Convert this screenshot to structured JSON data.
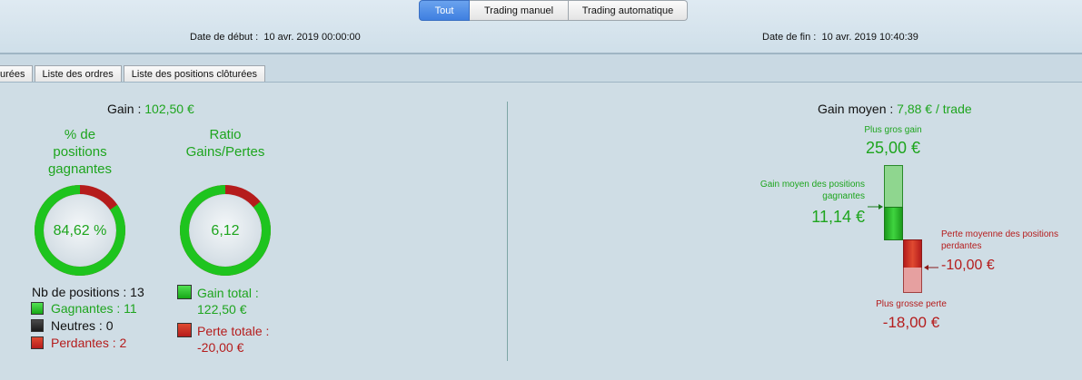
{
  "filter_tabs": [
    "Tout",
    "Trading manuel",
    "Trading automatique"
  ],
  "dates": {
    "start_label": "Date de début :",
    "start_value": "10 avr. 2019 00:00:00",
    "end_label": "Date de fin :",
    "end_value": "10 avr. 2019 10:40:39"
  },
  "tabs": [
    "urées",
    "Liste des ordres",
    "Liste des positions clôturées"
  ],
  "left": {
    "gain_label": "Gain :",
    "gain_value": "102,50 €",
    "pct_title_1": "% de",
    "pct_title_2": "positions",
    "pct_title_3": "gagnantes",
    "pct_value": "84,62 %",
    "pct_fraction": 0.8462,
    "ratio_title_1": "Ratio",
    "ratio_title_2": "Gains/Pertes",
    "ratio_value": "6,12",
    "ratio_fraction": 0.86,
    "nb_positions": "Nb de positions : 13",
    "gagnantes": "Gagnantes : 11",
    "neutres": "Neutres : 0",
    "perdantes": "Perdantes : 2",
    "gain_total_label": "Gain total :",
    "gain_total_value": "122,50 €",
    "perte_totale_label": "Perte totale :",
    "perte_totale_value": "-20,00 €"
  },
  "right": {
    "gain_moyen_label": "Gain moyen :",
    "gain_moyen_value": "7,88 € / trade",
    "max_gain_label": "Plus gros gain",
    "max_gain_value": "25,00 €",
    "avg_win_label_1": "Gain moyen des positions",
    "avg_win_label_2": "gagnantes",
    "avg_win_value": "11,14 €",
    "avg_loss_label_1": "Perte moyenne des positions",
    "avg_loss_label_2": "perdantes",
    "avg_loss_value": "-10,00 €",
    "max_loss_label": "Plus grosse perte",
    "max_loss_value": "-18,00 €"
  },
  "colors": {
    "green": "#1ea51e",
    "red": "#b51c1c",
    "accent_blue": "#3f7fe0"
  }
}
